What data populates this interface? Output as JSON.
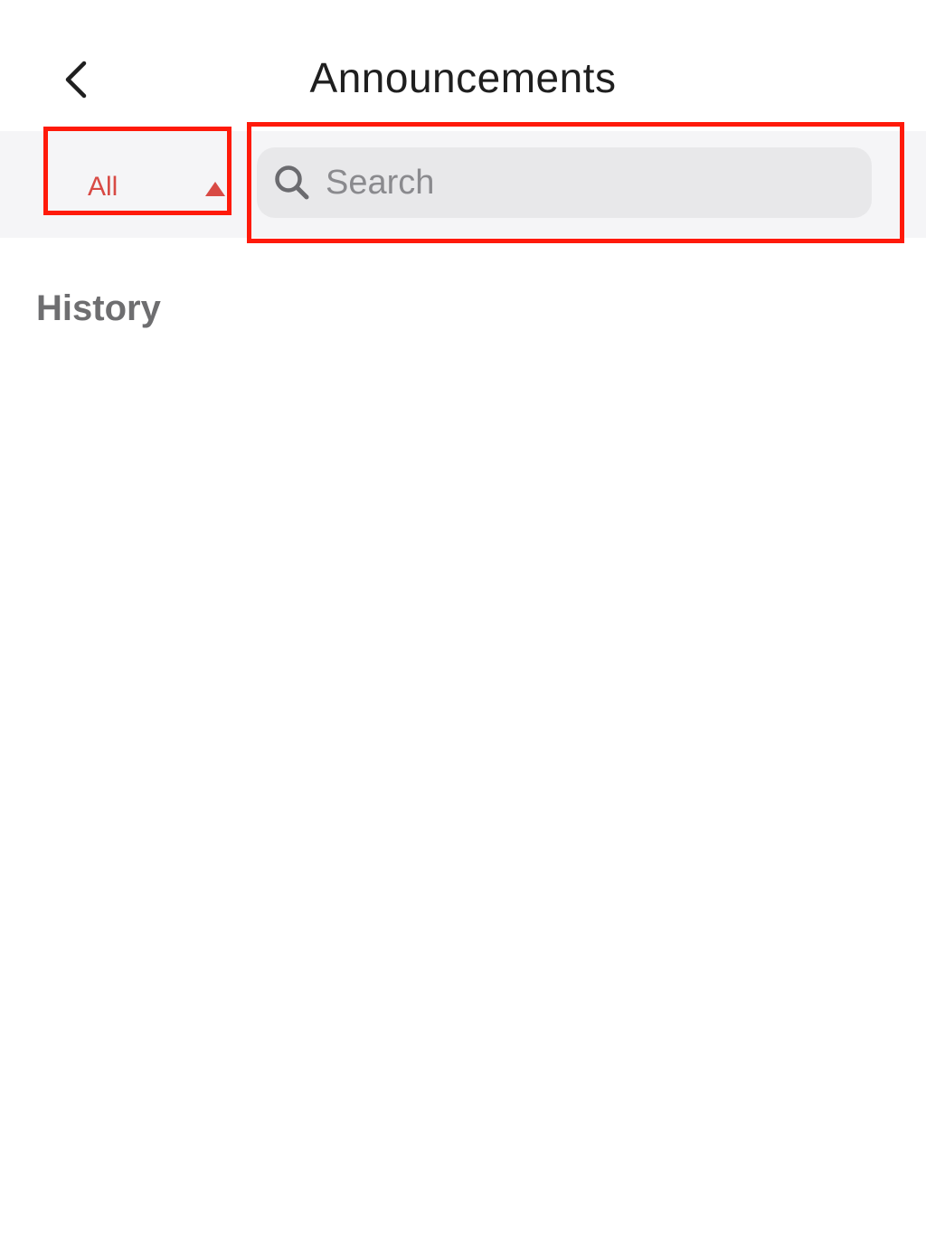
{
  "header": {
    "title": "Announcements",
    "back_icon": "chevron-left-icon"
  },
  "filter": {
    "selected": "All",
    "arrow_icon": "triangle-up-icon",
    "accent_color": "#d84a45"
  },
  "search": {
    "placeholder": "Search",
    "value": "",
    "icon": "search-icon"
  },
  "history": {
    "title": "History"
  },
  "highlight_color": "#ff1a0a"
}
